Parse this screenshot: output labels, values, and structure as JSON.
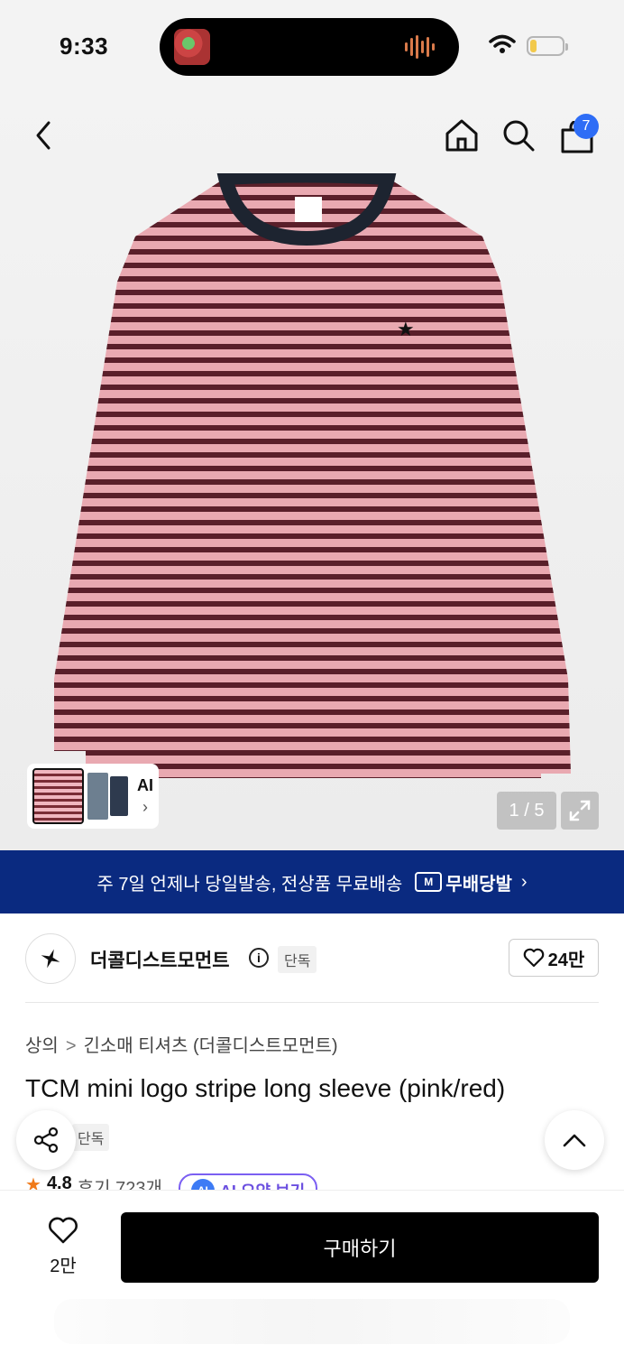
{
  "status_bar": {
    "time": "9:33"
  },
  "nav": {
    "cart_count": "7"
  },
  "gallery": {
    "counter": "1 / 5",
    "ai_label": "AI",
    "ai_chevron": "›"
  },
  "banner": {
    "text": "주 7일 언제나 당일발송, 전상품 무료배송",
    "badge_icon": "M",
    "badge_label": "무배당발",
    "chevron": "›"
  },
  "brand": {
    "name": "더콜디스트모먼트",
    "info": "i",
    "exclusive": "단독",
    "likes": "24만"
  },
  "breadcrumb": {
    "category": "상의",
    "separator": ">",
    "subcategory": "긴소매 티셔츠 (더콜디스트모먼트)"
  },
  "product": {
    "title": "TCM mini logo stripe long sleeve (pink/red)",
    "tag": "단독"
  },
  "rating": {
    "star": "★",
    "score": "4.8",
    "reviews_label": "후기 723개",
    "ai_icon": "AI",
    "ai_summary_label": "AI 요약 보기"
  },
  "bottom": {
    "like_count": "2만",
    "buy_label": "구매하기"
  },
  "colors": {
    "banner_bg": "#0a2a80",
    "accent_blue": "#2e6df6",
    "ai_purple": "#7b5ff2",
    "star_orange": "#f07a1a"
  },
  "icons": [
    "back-icon",
    "home-icon",
    "search-icon",
    "cart-icon",
    "expand-icon",
    "share-icon",
    "chevron-up-icon",
    "heart-icon",
    "info-icon",
    "wifi-icon",
    "battery-icon"
  ]
}
